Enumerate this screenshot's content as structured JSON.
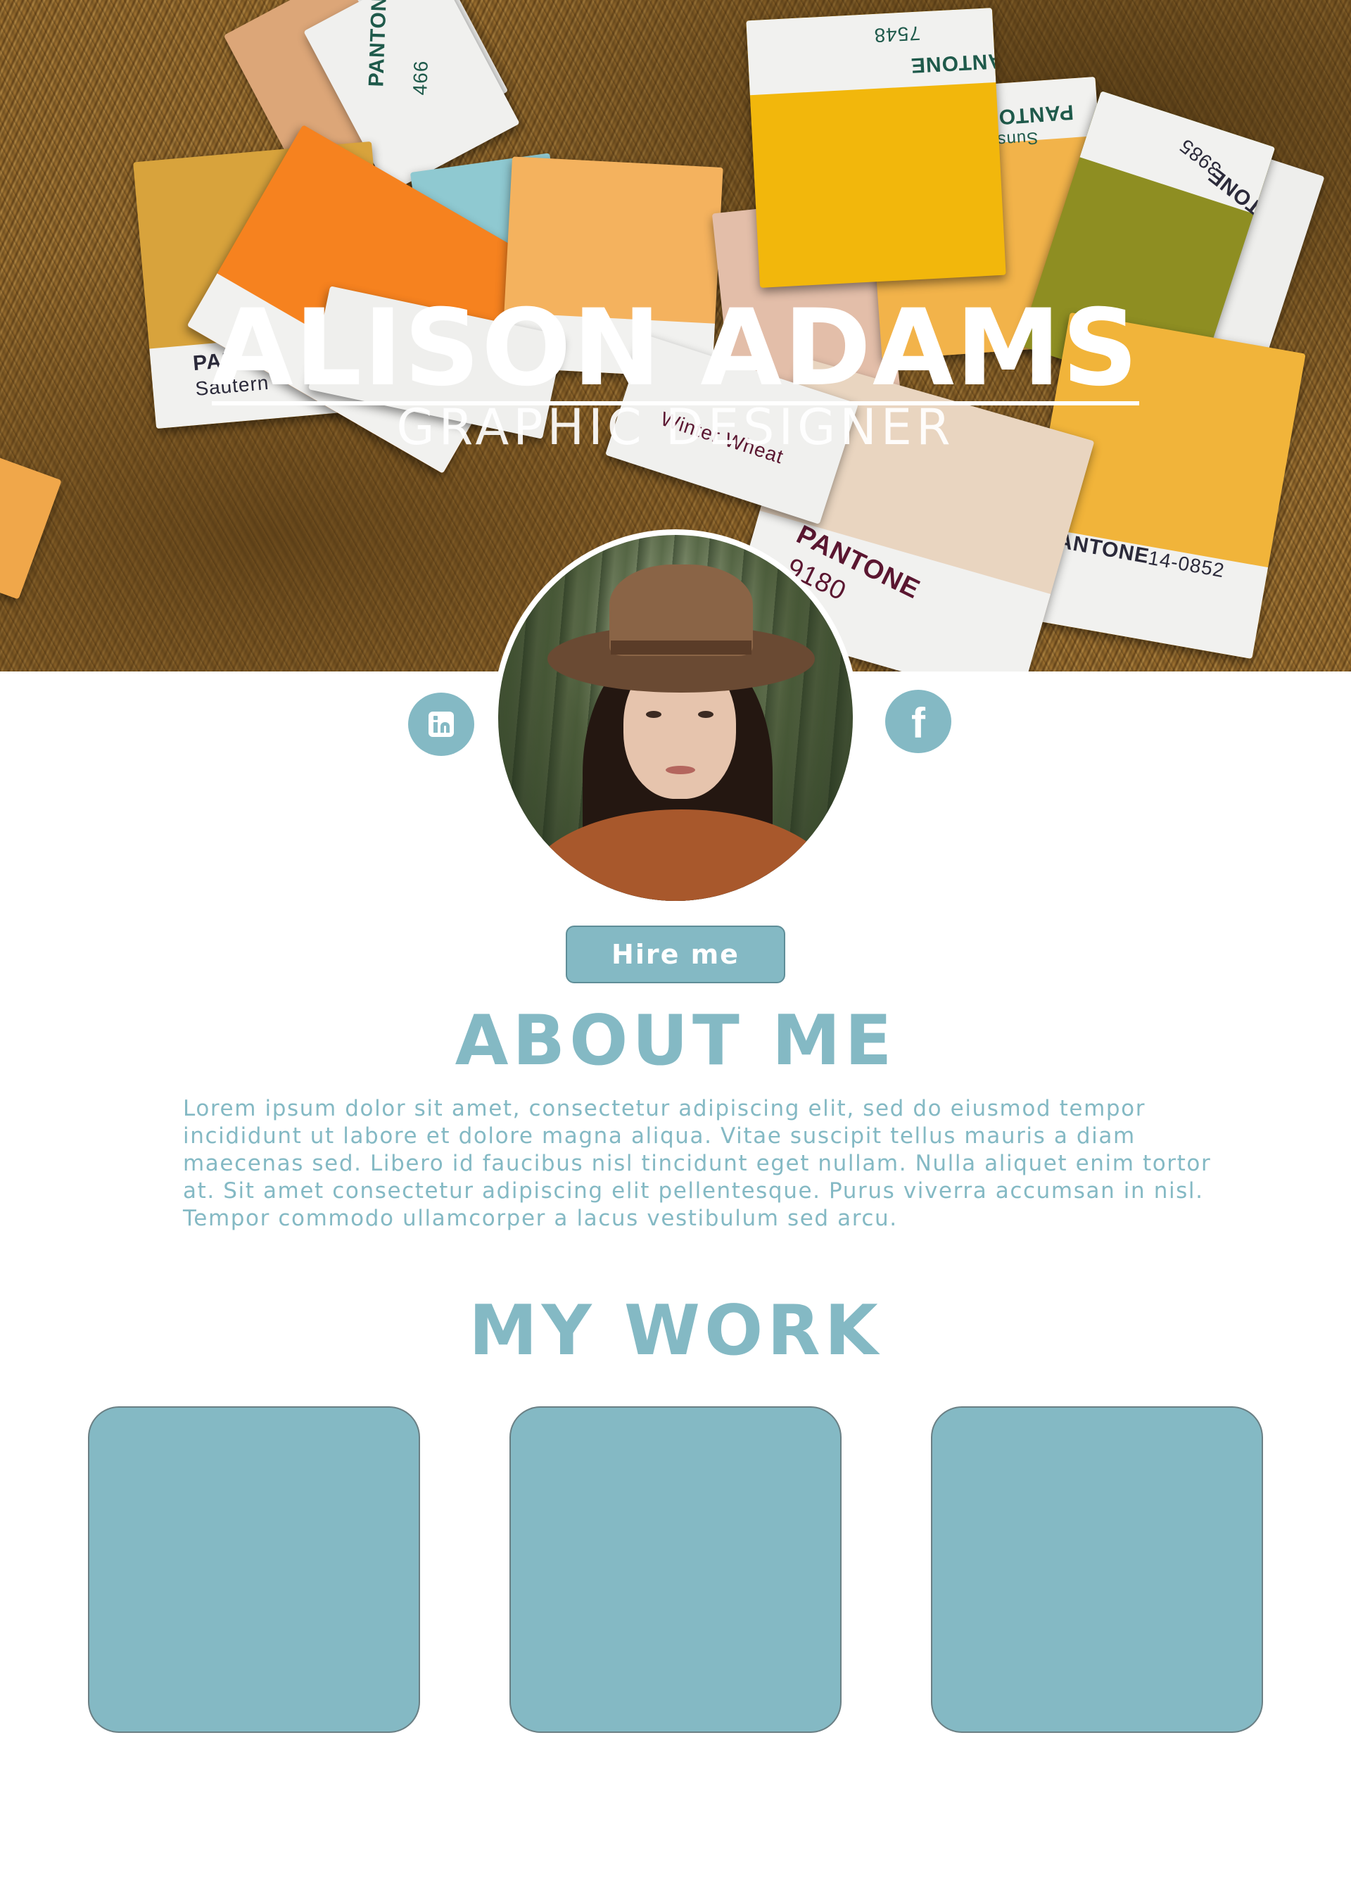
{
  "hero": {
    "name": "ALISON ADAMS",
    "role": "GRAPHIC DESIGNER",
    "swatches": [
      {
        "brand": "PANTONE",
        "code": "466"
      },
      {
        "brand": "PANTONE",
        "code": "7548"
      },
      {
        "brand": "PANTONE",
        "code": "Sunshine"
      },
      {
        "brand": "PANTONE",
        "code": "3985"
      },
      {
        "brand": "PANTONE",
        "code": "Sautern"
      },
      {
        "brand": "PANTONE",
        "code": "9180"
      },
      {
        "brand": "PANTONE",
        "code": "14-0852"
      },
      {
        "brand": "PANTONE",
        "code": "Winter Wheat"
      }
    ]
  },
  "social": {
    "linkedin_icon": "linkedin-icon",
    "facebook_icon": "facebook-icon",
    "facebook_glyph": "f"
  },
  "profile": {
    "hire_label": "Hire me"
  },
  "about": {
    "title": "ABOUT ME",
    "body": "Lorem ipsum dolor sit amet, consectetur adipiscing elit, sed do eiusmod tempor incididunt ut labore et dolore magna aliqua. Vitae suscipit tellus mauris a diam maecenas sed. Libero id faucibus nisl tincidunt eget nullam. Nulla aliquet enim tortor at. Sit amet consectetur adipiscing elit pellentesque. Purus viverra accumsan in nisl. Tempor commodo ullamcorper a lacus vestibulum sed arcu."
  },
  "work": {
    "title": "MY WORK",
    "items": [
      {
        "label": ""
      },
      {
        "label": ""
      },
      {
        "label": ""
      }
    ]
  },
  "colors": {
    "accent": "#84b9c4",
    "background": "#ffffff",
    "card_border": "#6a7f84"
  }
}
